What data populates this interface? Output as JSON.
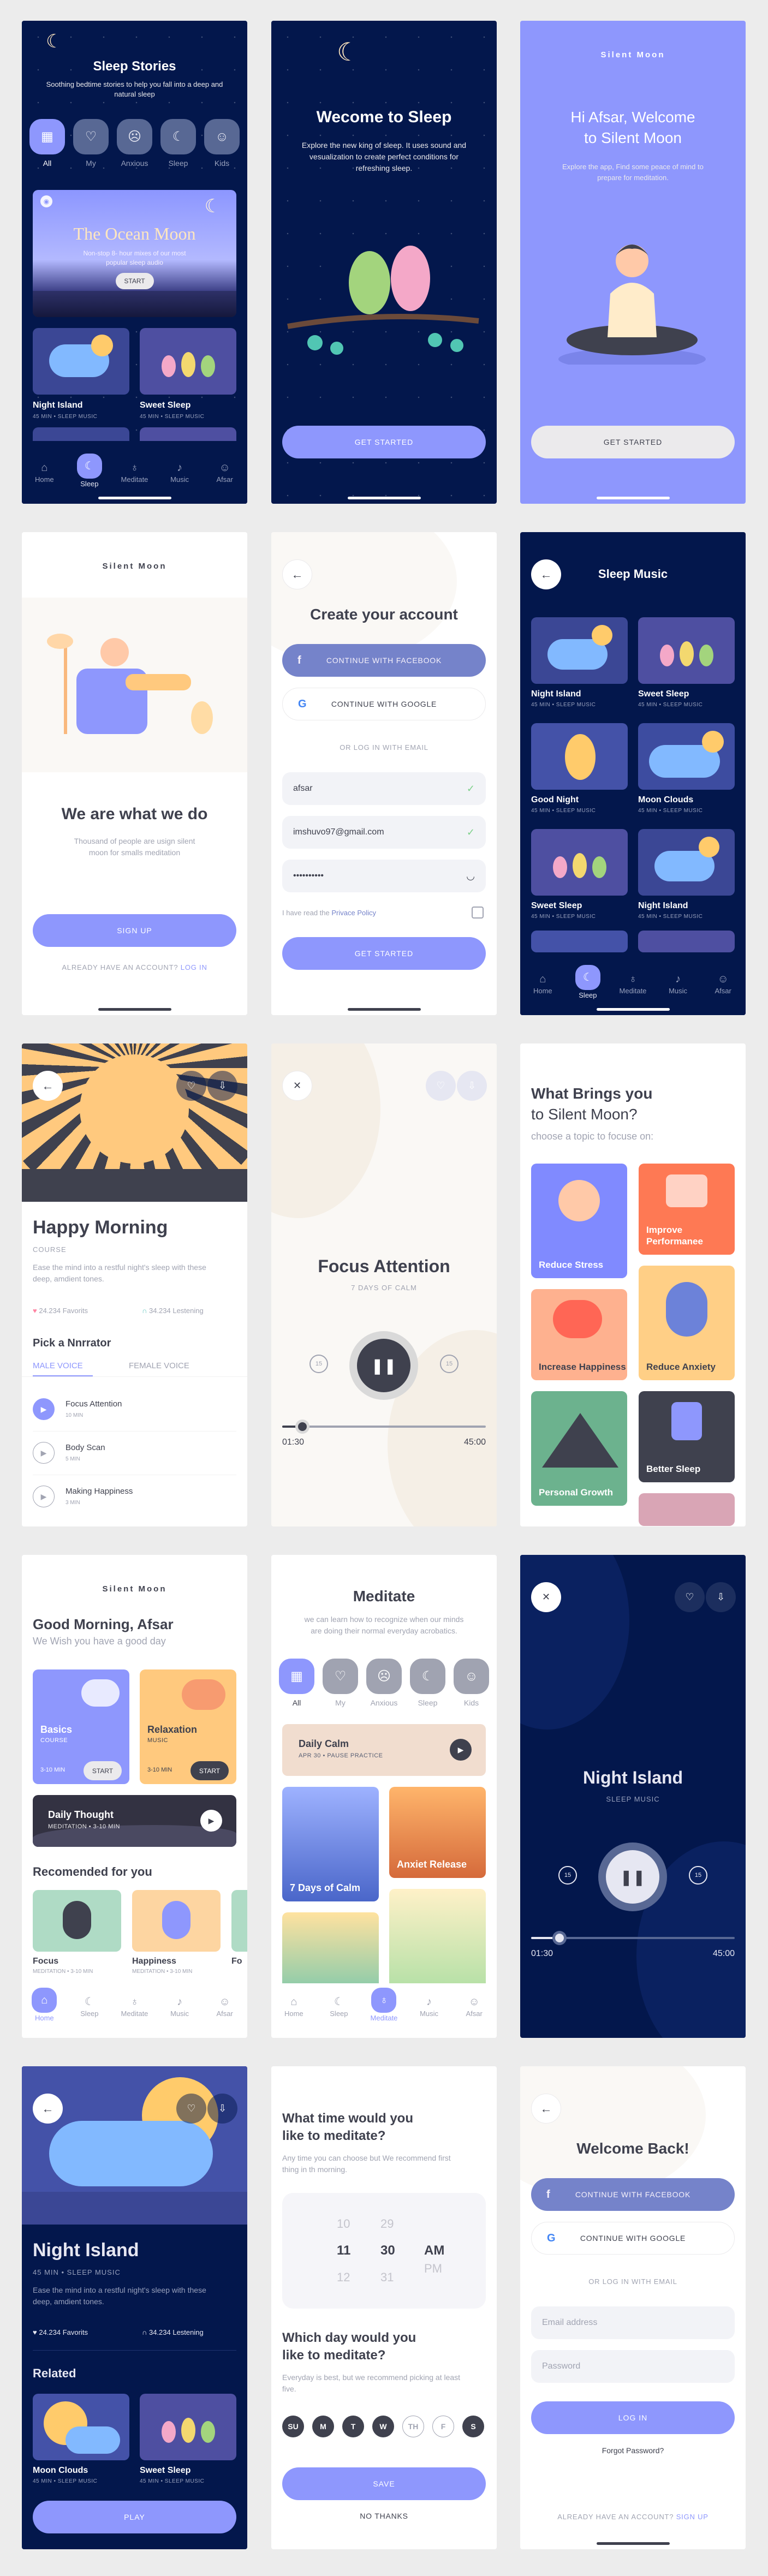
{
  "colors": {
    "accent": "#8e97fd",
    "dark": "#03174c",
    "text": "#3f414e",
    "muted": "#a1a4b2",
    "brand_yellow": "#ffc97e"
  },
  "sleep_stories": {
    "title": "Sleep Stories",
    "subtitle": "Soothing bedtime stories to help you fall into a deep and natural sleep",
    "categories": [
      "All",
      "My",
      "Anxious",
      "Sleep",
      "Kids"
    ],
    "featured": {
      "title": "The Ocean Moon",
      "desc": "Non-stop 8- hour mixes of our most popular sleep audio",
      "button": "START"
    },
    "cards": [
      {
        "title": "Night Island",
        "meta": "45 MIN • SLEEP MUSIC"
      },
      {
        "title": "Sweet Sleep",
        "meta": "45 MIN • SLEEP MUSIC"
      }
    ],
    "tabs": [
      "Home",
      "Sleep",
      "Meditate",
      "Music",
      "Afsar"
    ]
  },
  "welcome_sleep": {
    "title": "Wecome to Sleep",
    "desc": "Explore the new king of sleep. It uses sound and vesualization to create perfect conditions for refreshing sleep.",
    "button": "GET STARTED"
  },
  "welcome_afsar": {
    "brand": "Silent  Moon",
    "title": "Hi Afsar, Welcome\nto Silent Moon",
    "desc": "Explore the app, Find some peace of mind to prepare for meditation.",
    "button": "GET STARTED"
  },
  "we_are": {
    "brand": "Silent  Moon",
    "title": "We are what we do",
    "desc": "Thousand of people are usign silent moon for smalls meditation",
    "button": "SIGN UP",
    "footer_q": "ALREADY HAVE AN ACCOUNT?",
    "footer_link": "LOG IN"
  },
  "create_account": {
    "title": "Create your account",
    "facebook": "CONTINUE WITH FACEBOOK",
    "google": "CONTINUE WITH GOOGLE",
    "divider": "OR LOG IN WITH EMAIL",
    "name": "afsar",
    "email": "imshuvo97@gmail.com",
    "password": "••••••••••",
    "policy_text": "I have read the",
    "policy_link": "Privace Policy",
    "button": "GET STARTED"
  },
  "sleep_music": {
    "title": "Sleep Music",
    "cards": [
      {
        "title": "Night Island",
        "meta": "45 MIN • SLEEP MUSIC"
      },
      {
        "title": "Sweet Sleep",
        "meta": "45 MIN • SLEEP MUSIC"
      },
      {
        "title": "Good Night",
        "meta": "45 MIN • SLEEP MUSIC"
      },
      {
        "title": "Moon Clouds",
        "meta": "45 MIN • SLEEP MUSIC"
      },
      {
        "title": "Sweet Sleep",
        "meta": "45 MIN • SLEEP MUSIC"
      },
      {
        "title": "Night Island",
        "meta": "45 MIN • SLEEP MUSIC"
      }
    ],
    "tabs": [
      "Home",
      "Sleep",
      "Meditate",
      "Music",
      "Afsar"
    ]
  },
  "happy_morning": {
    "title": "Happy Morning",
    "course": "COURSE",
    "desc": "Ease the mind into a restful night's sleep  with these deep, amdient tones.",
    "favorites": "24.234 Favorits",
    "listening": "34.234 Lestening",
    "narrator_title": "Pick a Nnrrator",
    "voice_male": "MALE VOICE",
    "voice_female": "FEMALE VOICE",
    "tracks": [
      {
        "name": "Focus Attention",
        "dur": "10 MIN"
      },
      {
        "name": "Body Scan",
        "dur": "5 MIN"
      },
      {
        "name": "Making Happiness",
        "dur": "3 MIN"
      }
    ]
  },
  "focus": {
    "title": "Focus Attention",
    "subtitle": "7 DAYS OF CALM",
    "rewind": "15",
    "forward": "15",
    "progress": 0.1,
    "time_now": "01:30",
    "time_end": "45:00"
  },
  "what_brings": {
    "title": "What Brings you",
    "title2": "to Silent Moon?",
    "subtitle": "choose a topic to focuse on:",
    "topics": [
      "Reduce Stress",
      "Improve Performanee",
      "Increase Happiness",
      "Reduce Anxiety",
      "Personal Growth",
      "Better Sleep"
    ]
  },
  "home": {
    "brand": "Silent  Moon",
    "greeting": "Good Morning, Afsar",
    "sub": "We Wish you have a good day",
    "basics": {
      "title": "Basics",
      "tag": "COURSE",
      "dur": "3-10 MIN",
      "btn": "START"
    },
    "relaxation": {
      "title": "Relaxation",
      "tag": "MUSIC",
      "dur": "3-10 MIN",
      "btn": "START"
    },
    "daily": {
      "title": "Daily Thought",
      "meta": "MEDITATION • 3-10 MIN"
    },
    "recommended": "Recomended for you",
    "recs": [
      {
        "title": "Focus",
        "meta": "MEDITATION • 3-10 MIN"
      },
      {
        "title": "Happiness",
        "meta": "MEDITATION • 3-10 MIN"
      },
      {
        "title": "Fo",
        "meta": ""
      }
    ],
    "tabs": [
      "Home",
      "Sleep",
      "Meditate",
      "Music",
      "Afsar"
    ]
  },
  "meditate": {
    "title": "Meditate",
    "desc": "we can learn how to recognize when our minds are doing their normal everyday acrobatics.",
    "categories": [
      "All",
      "My",
      "Anxious",
      "Sleep",
      "Kids"
    ],
    "daily": {
      "title": "Daily Calm",
      "meta": "APR 30 • PAUSE PRACTICE"
    },
    "tiles": [
      "7 Days of Calm",
      "Anxiet Release"
    ],
    "tabs": [
      "Home",
      "Sleep",
      "Meditate",
      "Music",
      "Afsar"
    ]
  },
  "night_player": {
    "title": "Night Island",
    "subtitle": "SLEEP MUSIC",
    "rewind": "15",
    "forward": "15",
    "progress": 0.14,
    "time_now": "01:30",
    "time_end": "45:00"
  },
  "night_island": {
    "title": "Night Island",
    "meta": "45 MIN • SLEEP MUSIC",
    "desc": "Ease the mind into a restful night's sleep  with these deep, amdient tones.",
    "favorites": "24.234 Favorits",
    "listening": "34.234 Lestening",
    "related": "Related",
    "cards": [
      {
        "title": "Moon Clouds",
        "meta": "45 MIN • SLEEP MUSIC"
      },
      {
        "title": "Sweet Sleep",
        "meta": "45 MIN • SLEEP MUSIC"
      }
    ],
    "button": "PLAY"
  },
  "reminders": {
    "q1": "What time would you\nlike to meditate?",
    "d1": "Any time you can choose but We recommend first thing in th morning.",
    "hours": [
      "10",
      "11",
      "12"
    ],
    "minutes": [
      "29",
      "30",
      "31"
    ],
    "periods": [
      "AM",
      "PM"
    ],
    "q2": "Which day would you\nlike to meditate?",
    "d2": "Everyday is best, but we recommend picking at least five.",
    "days": [
      "SU",
      "M",
      "T",
      "W",
      "TH",
      "F",
      "S"
    ],
    "days_selected": [
      true,
      true,
      true,
      true,
      false,
      false,
      true
    ],
    "save": "SAVE",
    "no_thanks": "NO THANKS"
  },
  "welcome_back": {
    "title": "Welcome Back!",
    "facebook": "CONTINUE WITH FACEBOOK",
    "google": "CONTINUE WITH GOOGLE",
    "divider": "OR LOG IN WITH EMAIL",
    "email_ph": "Email address",
    "password_ph": "Password",
    "button": "LOG IN",
    "forgot": "Forgot Password?",
    "footer_q": "ALREADY HAVE AN ACCOUNT?",
    "footer_link": "SIGN UP"
  }
}
